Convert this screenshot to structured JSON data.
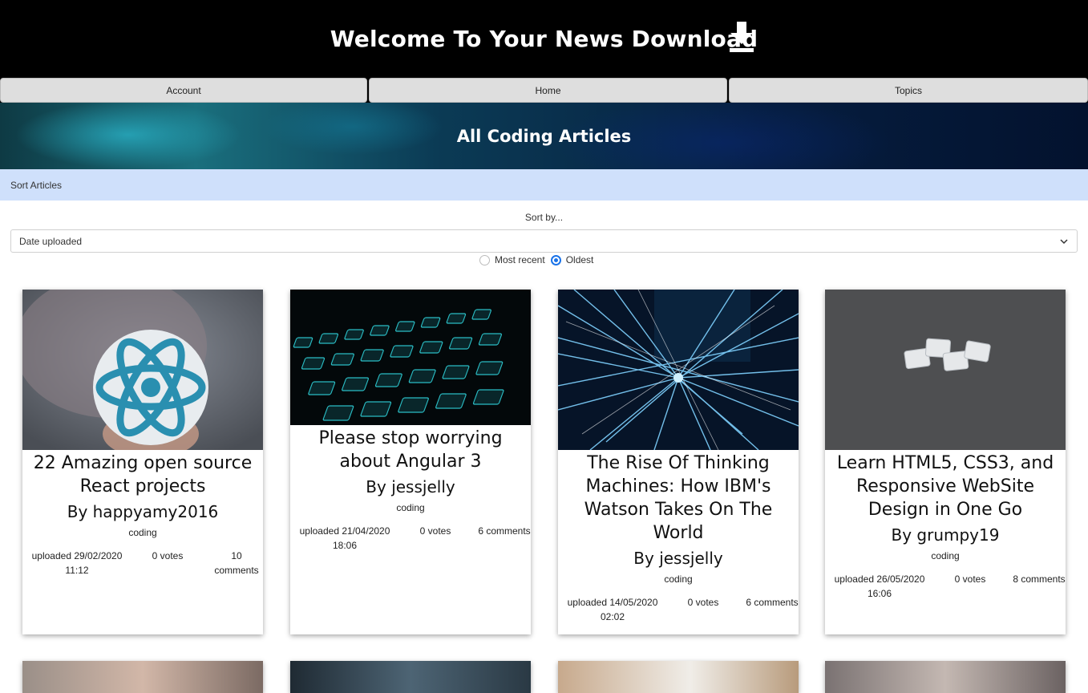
{
  "header": {
    "title": "Welcome To Your News Download"
  },
  "nav": {
    "items": [
      {
        "label": "Account"
      },
      {
        "label": "Home"
      },
      {
        "label": "Topics"
      }
    ]
  },
  "banner": {
    "title": "All Coding Articles"
  },
  "sort": {
    "bar_label": "Sort Articles",
    "label": "Sort by...",
    "selected": "Date uploaded",
    "order_options": [
      {
        "label": "Most recent",
        "checked": false
      },
      {
        "label": "Oldest",
        "checked": true
      }
    ]
  },
  "articles": [
    {
      "title": "22 Amazing open source React projects",
      "author": "By happyamy2016",
      "topic": "coding",
      "uploaded": "uploaded 29/02/2020 11:12",
      "votes": "0 votes",
      "comments": "10 comments",
      "image": "react-logo-image"
    },
    {
      "title": "Please stop worrying about Angular 3",
      "author": "By jessjelly",
      "topic": "coding",
      "uploaded": "uploaded 21/04/2020 18:06",
      "votes": "0 votes",
      "comments": "6 comments",
      "image": "keyboard-image"
    },
    {
      "title": "The Rise Of Thinking Machines: How IBM's Watson Takes On The World",
      "author": "By jessjelly",
      "topic": "coding",
      "uploaded": "uploaded 14/05/2020 02:02",
      "votes": "0 votes",
      "comments": "6 comments",
      "image": "network-lights-image"
    },
    {
      "title": "Learn HTML5, CSS3, and Responsive WebSite Design in One Go",
      "author": "By grumpy19",
      "topic": "coding",
      "uploaded": "uploaded 26/05/2020 16:06",
      "votes": "0 votes",
      "comments": "8 comments",
      "image": "html-tiles-image"
    }
  ],
  "colors": {
    "header_bg": "#000000",
    "sort_bar_bg": "#cfe0fb",
    "accent": "#1a73e8",
    "nav_bg": "#dedede"
  }
}
